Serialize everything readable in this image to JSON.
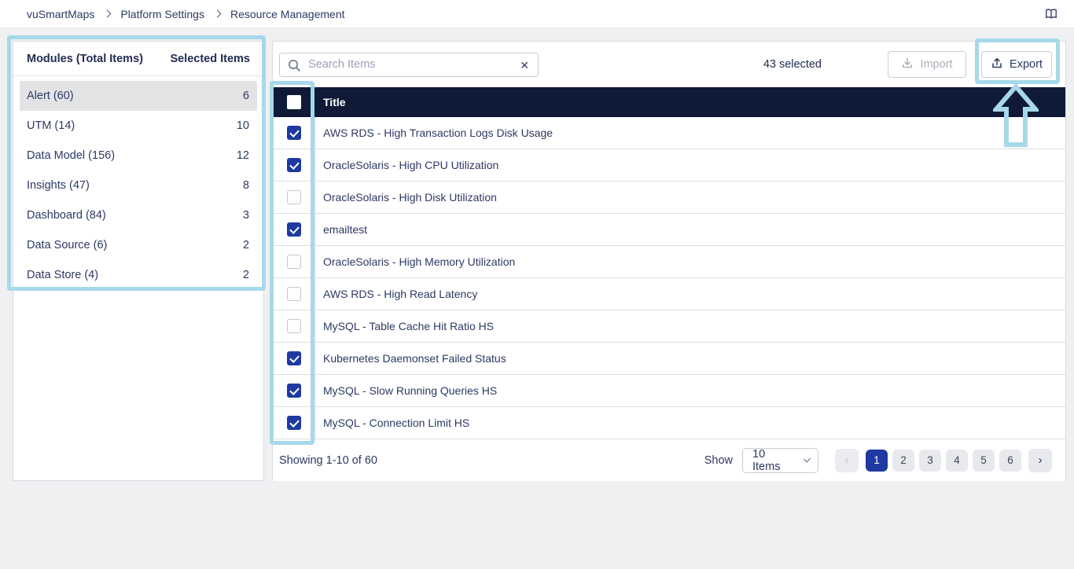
{
  "topbar": {
    "breadcrumb": [
      {
        "label": "vuSmartMaps"
      },
      {
        "label": "Platform Settings"
      },
      {
        "label": "Resource Management"
      }
    ]
  },
  "sidebar": {
    "modules_header": "Modules (Total Items)",
    "selected_header": "Selected Items",
    "items": [
      {
        "label": "Alert (60)",
        "count": "6",
        "active": true
      },
      {
        "label": "UTM (14)",
        "count": "10",
        "active": false
      },
      {
        "label": "Data Model (156)",
        "count": "12",
        "active": false
      },
      {
        "label": "Insights (47)",
        "count": "8",
        "active": false
      },
      {
        "label": "Dashboard (84)",
        "count": "3",
        "active": false
      },
      {
        "label": "Data Source (6)",
        "count": "2",
        "active": false
      },
      {
        "label": "Data Store (4)",
        "count": "2",
        "active": false
      }
    ]
  },
  "toolbar": {
    "search_placeholder": "Search Items",
    "clear_glyph": "✕",
    "selected_count": "43 selected",
    "import_label": "Import",
    "export_label": "Export"
  },
  "table": {
    "title_header": "Title",
    "rows": [
      {
        "title": "AWS RDS - High Transaction Logs Disk Usage",
        "checked": true
      },
      {
        "title": "OracleSolaris - High CPU Utilization",
        "checked": true
      },
      {
        "title": "OracleSolaris - High Disk Utilization",
        "checked": false
      },
      {
        "title": "emailtest",
        "checked": true
      },
      {
        "title": "OracleSolaris - High Memory Utilization",
        "checked": false
      },
      {
        "title": "AWS RDS - High Read Latency",
        "checked": false
      },
      {
        "title": "MySQL - Table Cache Hit Ratio HS",
        "checked": false
      },
      {
        "title": "Kubernetes Daemonset Failed Status",
        "checked": true
      },
      {
        "title": "MySQL - Slow Running Queries HS",
        "checked": true
      },
      {
        "title": "MySQL - Connection Limit HS",
        "checked": true
      }
    ]
  },
  "footer": {
    "showing": "Showing 1-10 of 60",
    "show_label": "Show",
    "page_size_value": "10 Items",
    "pages": [
      "1",
      "2",
      "3",
      "4",
      "5",
      "6"
    ],
    "active_page": "1",
    "prev_glyph": "‹",
    "next_glyph": "›"
  },
  "colors": {
    "accent_blue": "#1e3aa1",
    "table_header_navy": "#0e1a36",
    "annotation_blue": "#a6d8e9",
    "text_navy": "#2c3963",
    "sidebar_active_bg": "#e3e3e6"
  }
}
